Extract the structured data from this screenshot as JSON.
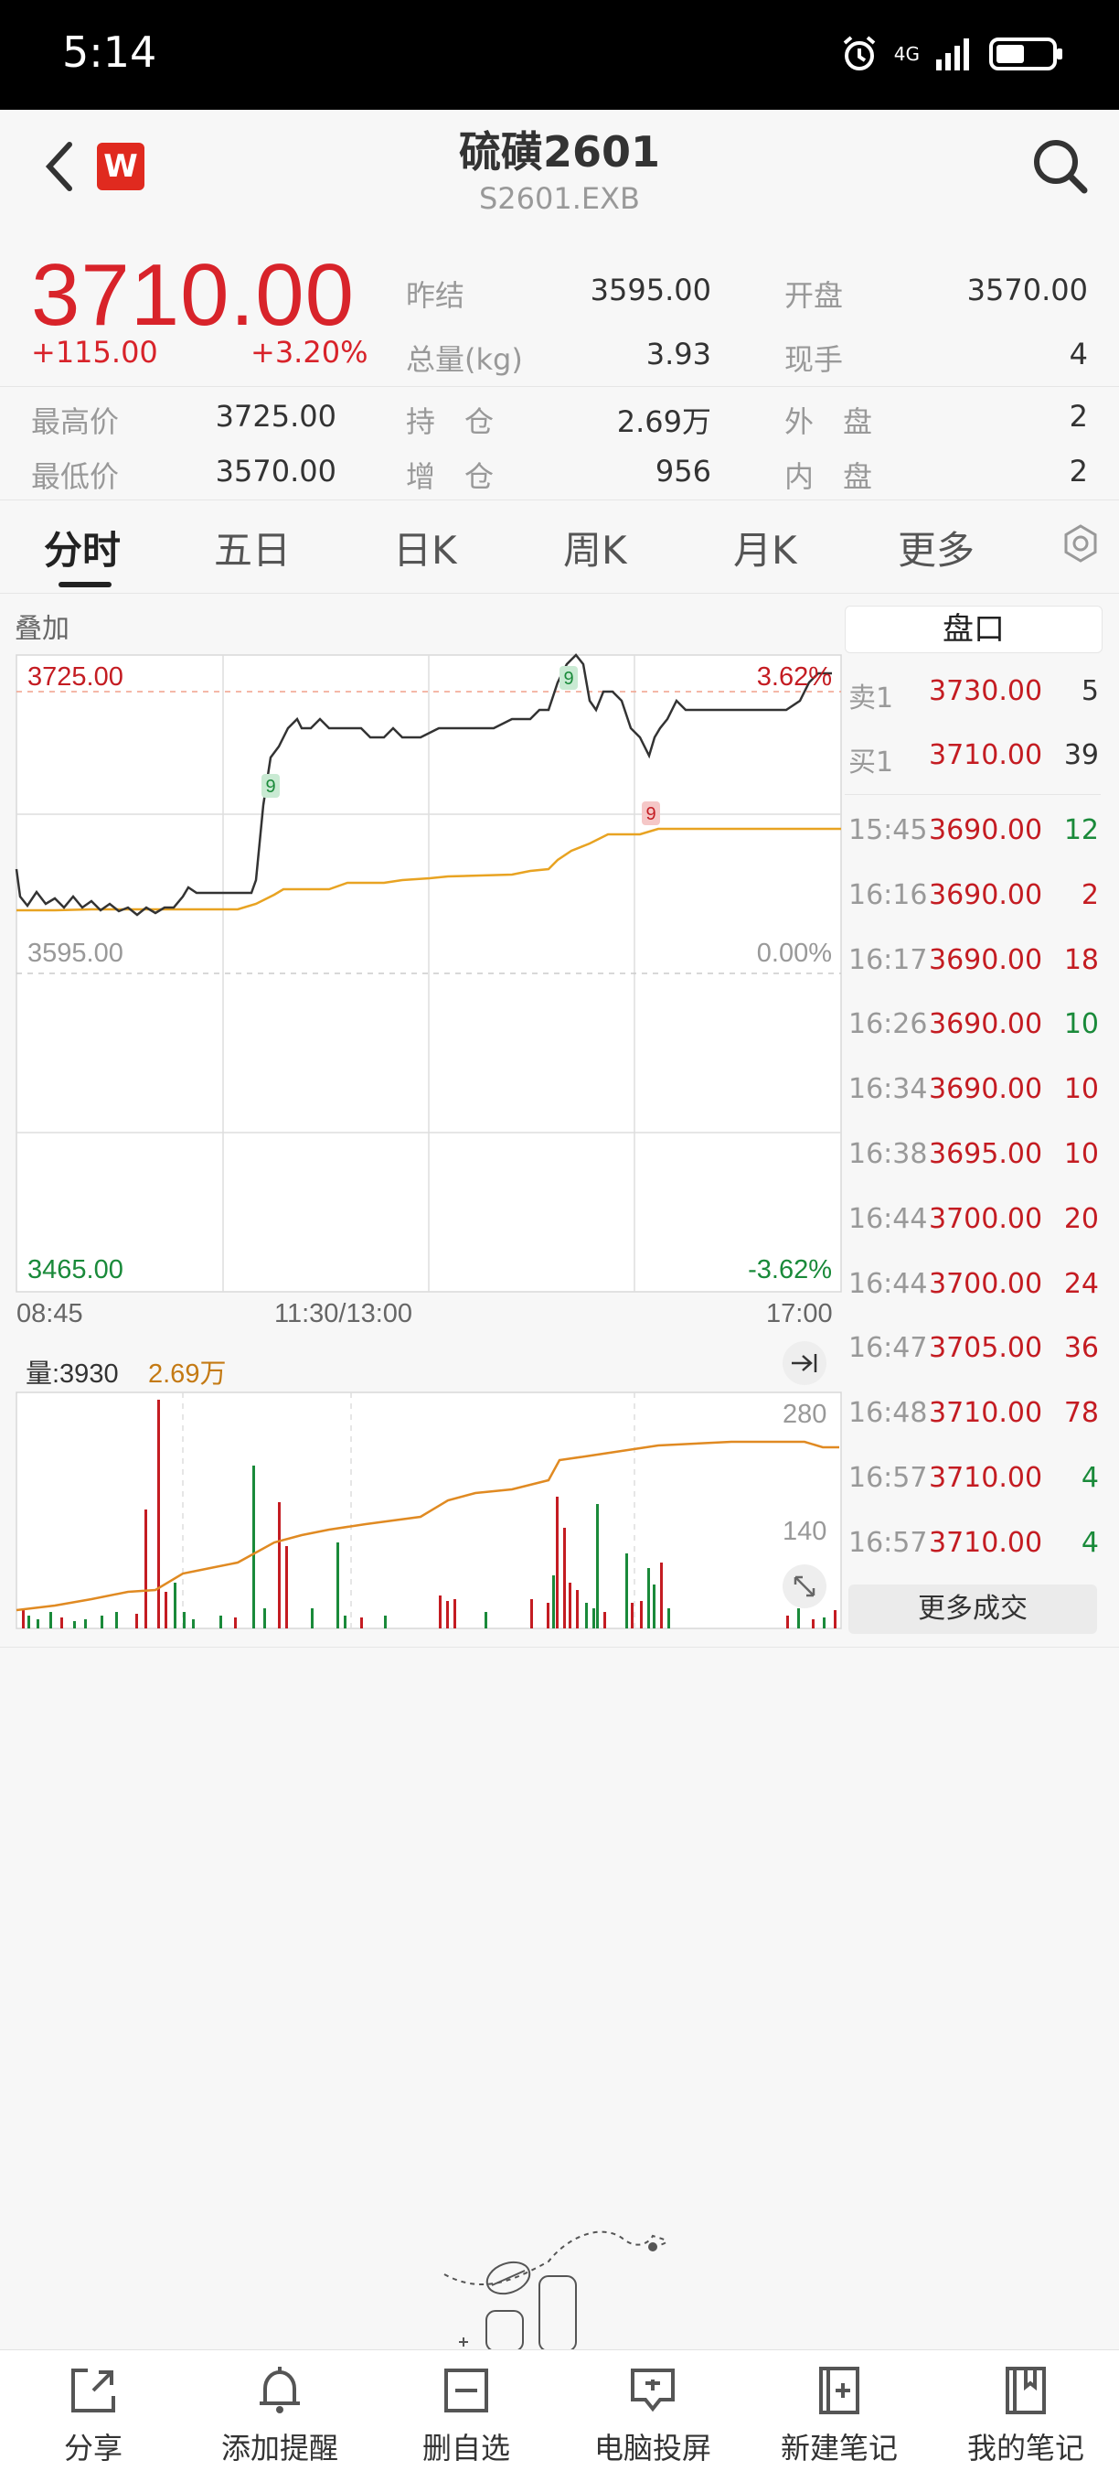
{
  "status_bar": {
    "time": "5:14",
    "network": "4G"
  },
  "header": {
    "title": "硫磺2601",
    "subtitle": "S2601.EXB",
    "badge": "W"
  },
  "quote": {
    "price": "3710.00",
    "change": "+115.00",
    "change_pct": "+3.20%",
    "rows": [
      {
        "label": "昨结",
        "value": "3595.00",
        "label2": "开盘",
        "value2": "3570.00"
      },
      {
        "label": "总量(kg)",
        "value": "3.93",
        "label2": "现手",
        "value2": "4"
      },
      {
        "label0": "最高价",
        "value0": "3725.00",
        "label": "持　仓",
        "value": "2.69万",
        "label2": "外　盘",
        "value2": "2"
      },
      {
        "label0": "最低价",
        "value0": "3570.00",
        "label": "增　仓",
        "value": "956",
        "label2": "内　盘",
        "value2": "2"
      }
    ]
  },
  "tabs": [
    "分时",
    "五日",
    "日K",
    "周K",
    "月K",
    "更多"
  ],
  "overlay_label": "叠加",
  "price_chart": {
    "y_top_label": "3725.00",
    "y_mid_label": "3595.00",
    "y_bottom_label": "3465.00",
    "pct_top": "3.62%",
    "pct_mid": "0.00%",
    "pct_bottom": "-3.62%",
    "x_labels": [
      "08:45",
      "11:30/13:00",
      "17:00"
    ],
    "marker_label": "9",
    "colors": {
      "price": "#333333",
      "avg": "#e8a322",
      "up": "#c41c22",
      "down": "#1a8a3a"
    }
  },
  "volume_chart": {
    "label": "量:3930",
    "oi_label": "2.69万",
    "tick_280": "280",
    "tick_140": "140"
  },
  "order_book": {
    "title": "盘口",
    "sell": {
      "label": "卖1",
      "price": "3730.00",
      "qty": "5"
    },
    "buy": {
      "label": "买1",
      "price": "3710.00",
      "qty": "39"
    },
    "trades": [
      {
        "time": "15:45",
        "price": "3690.00",
        "qty": "12",
        "dir": "down"
      },
      {
        "time": "16:16",
        "price": "3690.00",
        "qty": "2",
        "dir": "up"
      },
      {
        "time": "16:17",
        "price": "3690.00",
        "qty": "18",
        "dir": "up"
      },
      {
        "time": "16:26",
        "price": "3690.00",
        "qty": "10",
        "dir": "down"
      },
      {
        "time": "16:34",
        "price": "3690.00",
        "qty": "10",
        "dir": "up"
      },
      {
        "time": "16:38",
        "price": "3695.00",
        "qty": "10",
        "dir": "up"
      },
      {
        "time": "16:44",
        "price": "3700.00",
        "qty": "20",
        "dir": "up"
      },
      {
        "time": "16:44",
        "price": "3700.00",
        "qty": "24",
        "dir": "up"
      },
      {
        "time": "16:47",
        "price": "3705.00",
        "qty": "36",
        "dir": "up"
      },
      {
        "time": "16:48",
        "price": "3710.00",
        "qty": "78",
        "dir": "up"
      },
      {
        "time": "16:57",
        "price": "3710.00",
        "qty": "4",
        "dir": "down"
      },
      {
        "time": "16:57",
        "price": "3710.00",
        "qty": "4",
        "dir": "down"
      }
    ],
    "more_label": "更多成交"
  },
  "bottom_nav": [
    {
      "label": "分享",
      "icon": "share-icon"
    },
    {
      "label": "添加提醒",
      "icon": "bell-icon"
    },
    {
      "label": "删自选",
      "icon": "remove-watchlist-icon"
    },
    {
      "label": "电脑投屏",
      "icon": "screen-cast-icon"
    },
    {
      "label": "新建笔记",
      "icon": "new-note-icon"
    },
    {
      "label": "我的笔记",
      "icon": "notebook-icon"
    }
  ]
}
